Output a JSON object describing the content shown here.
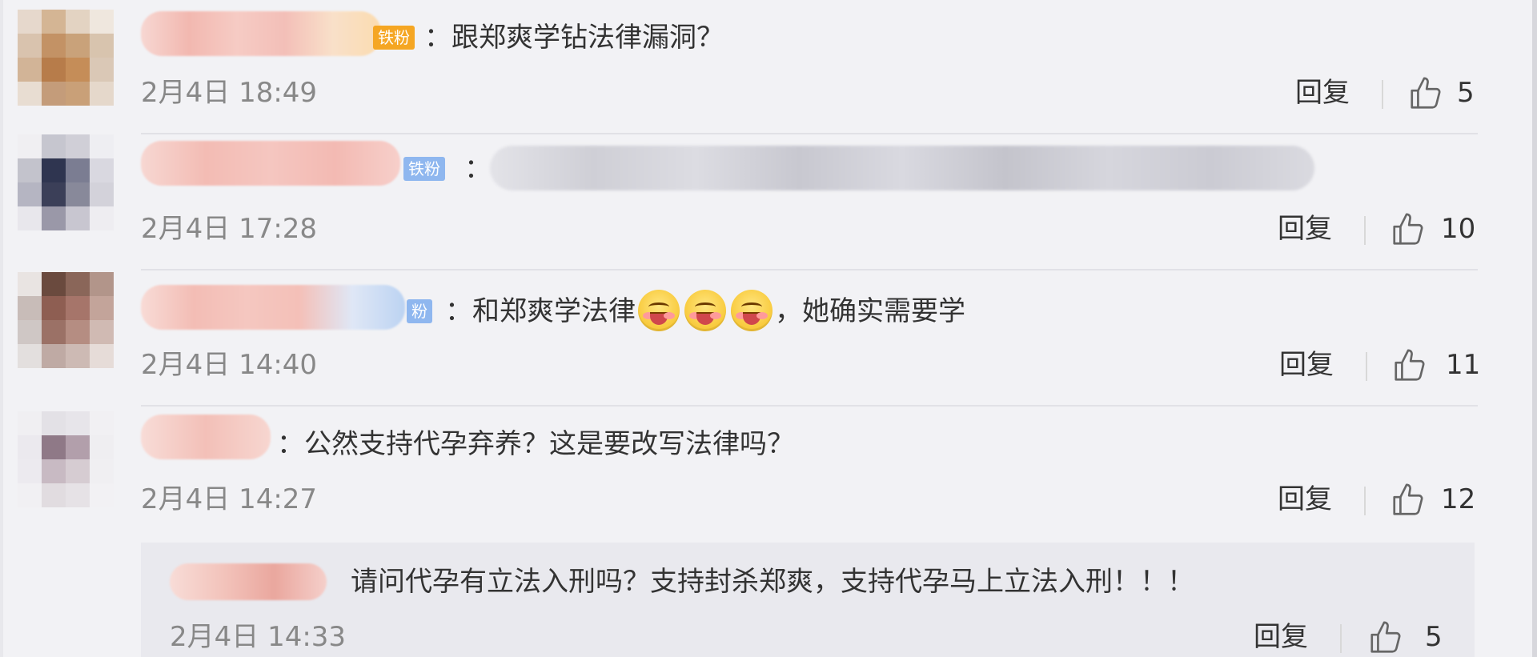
{
  "comments": [
    {
      "badge": "铁粉",
      "text": "：跟郑爽学钻法律漏洞？",
      "time": "2月4日 18:49",
      "reply": "回复",
      "likes": "5",
      "badge_color": "#f5a623"
    },
    {
      "badge": "铁粉",
      "text": "：",
      "time": "2月4日 17:28",
      "reply": "回复",
      "likes": "10",
      "badge_color": "#8fb7ef"
    },
    {
      "badge": "粉",
      "text_before": "：和郑爽学法律",
      "text_after": "，她确实需要学",
      "emoji": "grinning-face-emoji",
      "time": "2月4日 14:40",
      "reply": "回复",
      "likes": "11",
      "badge_color": "#8fb7ef"
    },
    {
      "text": "：公然支持代孕弃养？这是要改写法律吗？",
      "time": "2月4日 14:27",
      "reply": "回复",
      "likes": "12"
    }
  ],
  "sub_reply": {
    "text": "请问代孕有立法入刑吗？支持封杀郑爽，支持代孕马上立法入刑！！！",
    "time": "2月4日 14:33",
    "reply": "回复",
    "likes": "5"
  },
  "icons": {
    "like": "thumbs-up-icon"
  }
}
